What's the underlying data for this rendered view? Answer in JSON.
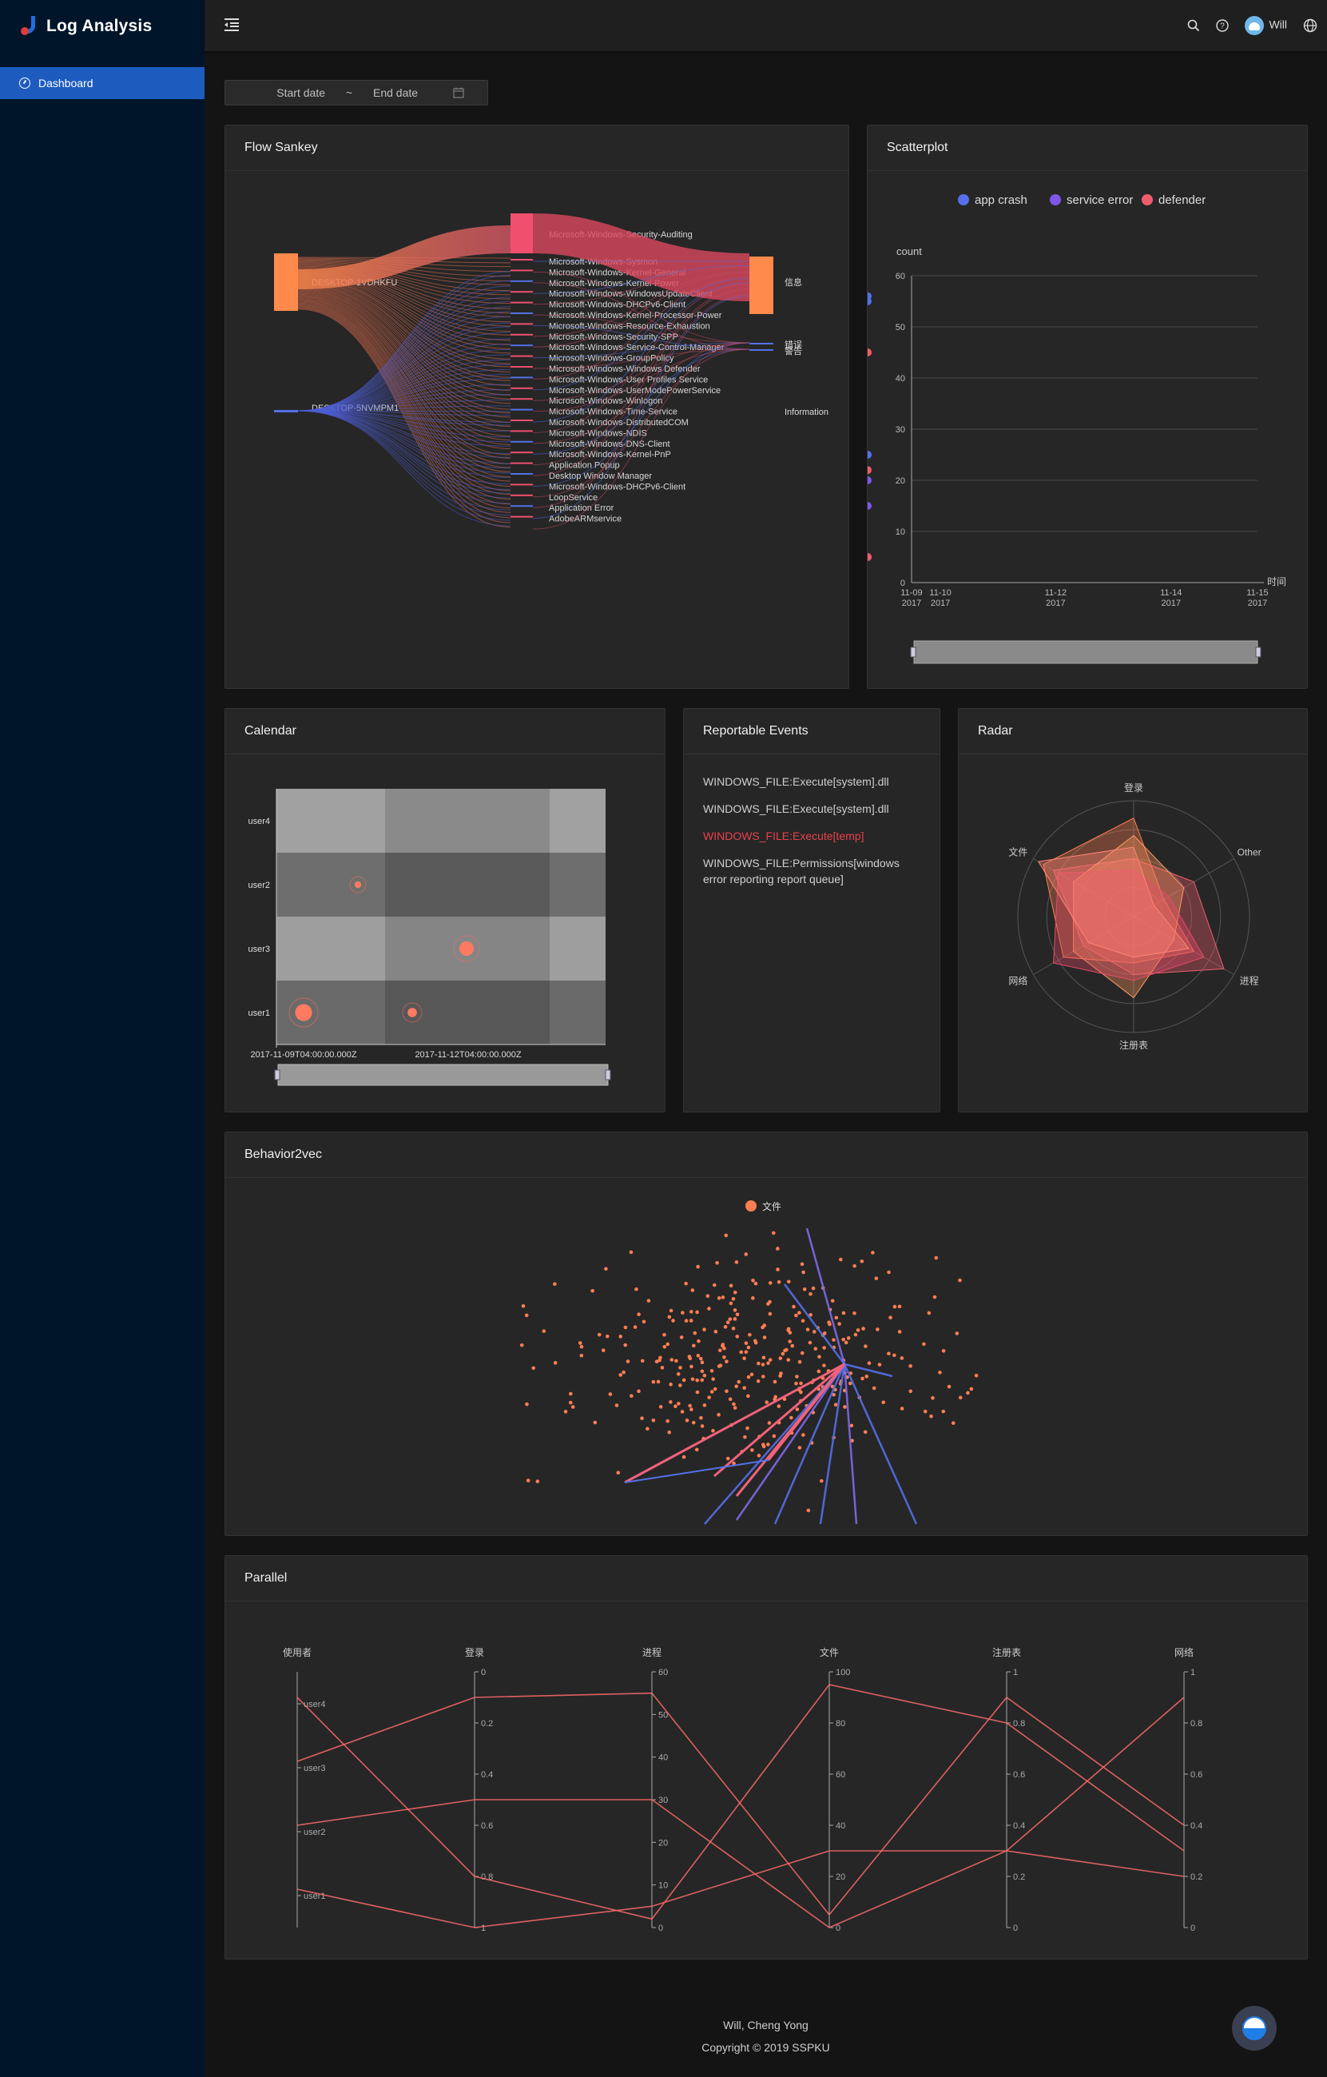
{
  "app": {
    "title": "Log Analysis"
  },
  "sidebar": {
    "items": [
      {
        "label": "Dashboard",
        "icon": "dashboard-icon"
      }
    ]
  },
  "header": {
    "user": "Will",
    "icons": [
      "search-icon",
      "question-icon",
      "globe-icon"
    ]
  },
  "date_range": {
    "start_placeholder": "Start date",
    "separator": "~",
    "end_placeholder": "End date"
  },
  "cards": {
    "sankey": "Flow Sankey",
    "scatter": "Scatterplot",
    "calendar": "Calendar",
    "events": "Reportable Events",
    "radar": "Radar",
    "behavior": "Behavior2vec",
    "parallel": "Parallel"
  },
  "events": [
    {
      "text": "WINDOWS_FILE:Execute[system].dll",
      "highlight": false
    },
    {
      "text": "WINDOWS_FILE:Execute[system].dll",
      "highlight": false
    },
    {
      "text": "WINDOWS_FILE:Execute[temp]",
      "highlight": true
    },
    {
      "text": "WINDOWS_FILE:Permissions[windows error reporting report queue]",
      "highlight": false
    }
  ],
  "colors": {
    "accent": "#1d5bbf",
    "red": "#e8414b",
    "blue": "#5470e8",
    "purple": "#7e57e8",
    "pink": "#ee5d6c",
    "orange": "#ff7e52"
  },
  "chart_data": [
    {
      "type": "sankey",
      "title": "Flow Sankey",
      "sources": [
        "DESKTOP-1VDHKFU",
        "DESKTOP-5NVMPM1"
      ],
      "middle_labels": [
        "Microsoft-Windows-Security-Auditing",
        "Microsoft-Windows-Sysmon",
        "Microsoft-Windows-Kernel-General",
        "Microsoft-Windows-Kernel-Power",
        "Microsoft-Windows-WindowsUpdateClient",
        "Microsoft-Windows-DHCPv6-Client",
        "Microsoft-Windows-Kernel-Processor-Power",
        "Microsoft-Windows-Resource-Exhaustion",
        "Microsoft-Windows-Security-SPP",
        "Microsoft-Windows-Service-Control-Manager",
        "Microsoft-Windows-GroupPolicy",
        "Microsoft-Windows-Windows Defender",
        "Microsoft-Windows-User Profiles Service",
        "Microsoft-Windows-UserModePowerService",
        "Microsoft-Windows-Winlogon",
        "Microsoft-Windows-Time-Service",
        "Microsoft-Windows-DistributedCOM",
        "Microsoft-Windows-NDIS",
        "Microsoft-Windows-DNS-Client",
        "Microsoft-Windows-Kernel-PnP",
        "Application Popup",
        "Desktop Window Manager",
        "Microsoft-Windows-DHCPv6-Client",
        "LoopService",
        "Application Error",
        "AdobeARMservice"
      ],
      "targets": [
        "信息",
        "错误",
        "警告",
        "Information"
      ]
    },
    {
      "type": "scatter",
      "title": "Scatterplot",
      "ylabel": "count",
      "xlabel": "时间",
      "ylim": [
        0,
        60
      ],
      "x_ticks": [
        "11-09\n2017",
        "11-10\n2017",
        "11-12\n2017",
        "11-14\n2017",
        "11-15\n2017"
      ],
      "series": [
        {
          "name": "app crash",
          "color": "#5470e8",
          "points": [
            [
              "2017-11-13T20",
              55
            ],
            [
              "2017-11-15T00",
              56
            ],
            [
              "2017-11-13T20",
              25
            ],
            [
              "2017-11-13T20",
              5
            ]
          ]
        },
        {
          "name": "service error",
          "color": "#7e57e8",
          "points": [
            [
              "2017-11-12T12",
              20
            ],
            [
              "2017-11-13T10",
              15
            ]
          ]
        },
        {
          "name": "defender",
          "color": "#ee5d6c",
          "points": [
            [
              "2017-11-09T00",
              22
            ],
            [
              "2017-11-13T04",
              5
            ],
            [
              "2017-11-14T16",
              45
            ]
          ]
        }
      ]
    },
    {
      "type": "heatmap",
      "title": "Calendar",
      "y_categories": [
        "user4",
        "user2",
        "user3",
        "user1"
      ],
      "x_labels": [
        "2017-11-09T04:00:00.000Z",
        "2017-11-12T04:00:00.000Z"
      ],
      "bubbles": [
        {
          "user": "user2",
          "col": 1,
          "value": 2
        },
        {
          "user": "user3",
          "col": 3,
          "value": 5
        },
        {
          "user": "user1",
          "col": 0,
          "value": 6
        },
        {
          "user": "user1",
          "col": 2,
          "value": 3
        }
      ]
    },
    {
      "type": "radar",
      "title": "Radar",
      "indicators": [
        "登录",
        "Other",
        "进程",
        "注册表",
        "网络",
        "文件"
      ]
    },
    {
      "type": "scatter",
      "title": "Behavior2vec",
      "legend": [
        "文件"
      ]
    },
    {
      "type": "parallel",
      "title": "Parallel",
      "axes": [
        {
          "name": "使用者",
          "ticks": [
            "user1",
            "user2",
            "user3",
            "user4"
          ]
        },
        {
          "name": "登录",
          "ticks": [
            "0",
            "0.2",
            "0.4",
            "0.6",
            "0.8",
            "1"
          ]
        },
        {
          "name": "进程",
          "ticks": [
            "0",
            "10",
            "20",
            "30",
            "40",
            "50",
            "60"
          ]
        },
        {
          "name": "文件",
          "ticks": [
            "0",
            "20",
            "40",
            "60",
            "80",
            "100"
          ]
        },
        {
          "name": "注册表",
          "ticks": [
            "0",
            "0.2",
            "0.4",
            "0.6",
            "0.8",
            "1"
          ]
        },
        {
          "name": "网络",
          "ticks": [
            "0",
            "0.2",
            "0.4",
            "0.6",
            "0.8",
            "1"
          ]
        }
      ],
      "lines": [
        {
          "user": "user4",
          "values": [
            0.9,
            0.8,
            2,
            95,
            0.8,
            0.3
          ]
        },
        {
          "user": "user3",
          "values": [
            0.65,
            0.1,
            55,
            5,
            0.9,
            0.4
          ]
        },
        {
          "user": "user2",
          "values": [
            0.4,
            0.5,
            30,
            0,
            0.3,
            0.9
          ]
        },
        {
          "user": "user1",
          "values": [
            0.15,
            1,
            5,
            30,
            0.3,
            0.2
          ]
        }
      ]
    }
  ],
  "footer": {
    "line1": "Will, Cheng Yong",
    "line2": "Copyright © 2019 SSPKU"
  }
}
